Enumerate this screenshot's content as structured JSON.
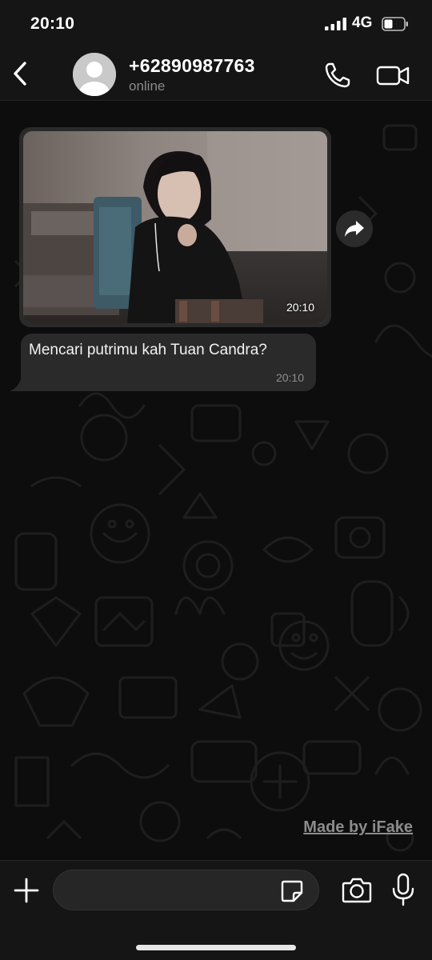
{
  "status_bar": {
    "time": "20:10",
    "network": "4G",
    "icons": [
      "signal-bars-icon",
      "battery-icon"
    ]
  },
  "header": {
    "contact_name": "+62890987763",
    "contact_status": "online",
    "icons": [
      "back-chevron-icon",
      "default-avatar-icon",
      "phone-icon",
      "video-camera-icon"
    ]
  },
  "messages": [
    {
      "type": "photo",
      "time": "20:10",
      "description_icon": "photo-message"
    },
    {
      "type": "text",
      "text": "Mencari putrimu kah Tuan Candra?",
      "time": "20:10"
    }
  ],
  "watermark": "Made by iFake",
  "input_bar": {
    "placeholder": "",
    "icons": [
      "plus-icon",
      "sticker-icon",
      "camera-icon",
      "microphone-icon"
    ]
  },
  "colors": {
    "background": "#0d0d0d",
    "bars": "#151515",
    "bubble": "#2a2a2a",
    "muted_text": "#8a8a8a"
  }
}
